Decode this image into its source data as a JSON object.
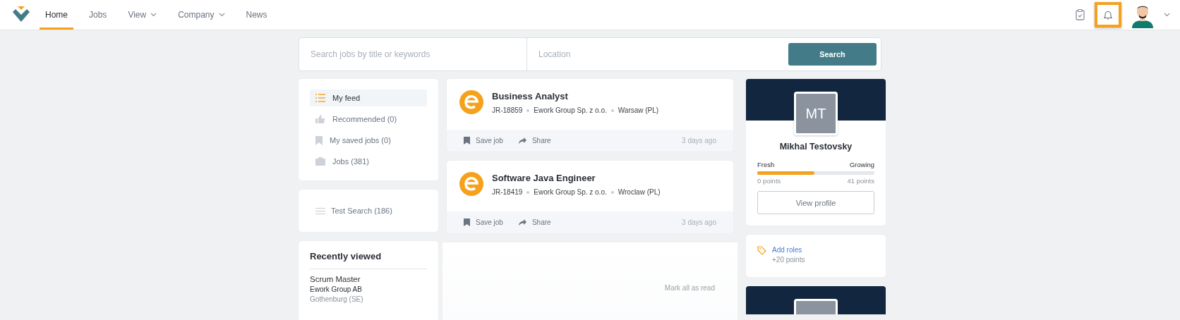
{
  "nav": {
    "tabs": [
      {
        "label": "Home",
        "selected": true,
        "dropdown": false
      },
      {
        "label": "Jobs",
        "selected": false,
        "dropdown": false
      },
      {
        "label": "View",
        "selected": false,
        "dropdown": true
      },
      {
        "label": "Company",
        "selected": false,
        "dropdown": true
      },
      {
        "label": "News",
        "selected": false,
        "dropdown": false
      }
    ],
    "bell_highlighted": true
  },
  "search": {
    "keywords_placeholder": "Search jobs by title or keywords",
    "location_placeholder": "Location",
    "button": "Search"
  },
  "feed_menu": [
    {
      "label": "My feed",
      "kind": "list",
      "selected": true
    },
    {
      "label": "Recommended (0)",
      "kind": "thumb",
      "selected": false
    },
    {
      "label": "My saved jobs (0)",
      "kind": "bookmark",
      "selected": false
    },
    {
      "label": "Jobs (381)",
      "kind": "briefcase",
      "selected": false
    }
  ],
  "saved_searches": [
    {
      "label": "Test Search (186)"
    }
  ],
  "recently_viewed": {
    "title": "Recently viewed",
    "items": [
      {
        "title": "Scrum Master",
        "company": "Ework Group AB",
        "location": "Gothenburg (SE)"
      }
    ]
  },
  "jobs": [
    {
      "title": "Business Analyst",
      "ref": "JR-18859",
      "company": "Ework Group Sp. z o.o.",
      "location": "Warsaw (PL)",
      "save": "Save job",
      "share": "Share",
      "posted": "3 days ago"
    },
    {
      "title": "Software Java Engineer",
      "ref": "JR-18419",
      "company": "Ework Group Sp. z o.o.",
      "location": "Wroclaw (PL)",
      "save": "Save job",
      "share": "Share",
      "posted": "3 days ago"
    }
  ],
  "notifications": {
    "action": "Mark all as read"
  },
  "profile": {
    "initials": "MT",
    "name": "Mikhal Testovsky",
    "level_from": "Fresh",
    "level_to": "Growing",
    "level": 0.49,
    "points_from": "0 points",
    "points_to": "41 points",
    "button": "View profile"
  },
  "tasks": [
    {
      "label": "Add roles",
      "reward": "+20 points"
    }
  ]
}
